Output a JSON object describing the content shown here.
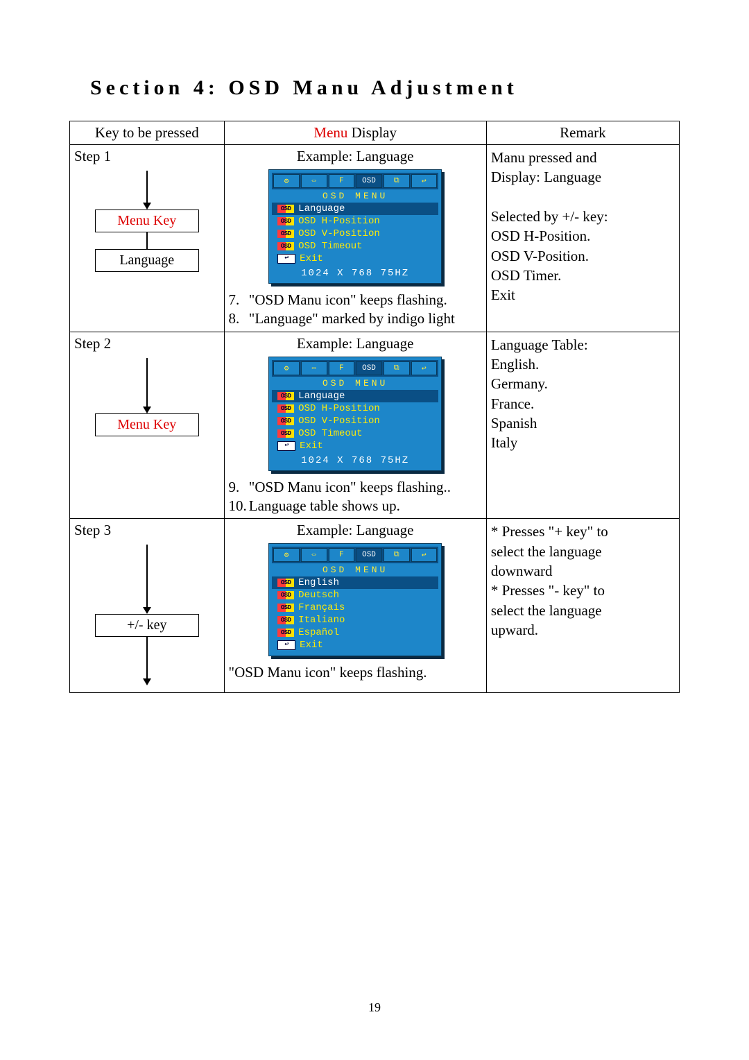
{
  "section_title": "Section 4: OSD Manu Adjustment",
  "page_number": "19",
  "table_header": {
    "col_key": "Key to be pressed",
    "col_display_prefix": "Menu",
    "col_display_suffix": " Display",
    "col_remark": "Remark"
  },
  "osd_common": {
    "menu_title": "OSD   MENU",
    "resolution": "1024 X 768 75HZ",
    "tabs": [
      "⚙",
      "⇔",
      "F",
      "OSD",
      "⧉",
      "↩"
    ]
  },
  "step1": {
    "label": "Step 1",
    "key_box1": "Menu Key",
    "key_box2": "Language",
    "display_caption": "Example: Language",
    "osd_items": [
      {
        "tag": "OSD",
        "text": "Language",
        "selected": true
      },
      {
        "tag": "OSD",
        "text": "OSD H-Position",
        "selected": false
      },
      {
        "tag": "OSD",
        "text": "OSD V-Position",
        "selected": false
      },
      {
        "tag": "OSD",
        "text": "OSD Timeout",
        "selected": false
      },
      {
        "tag": "EXIT",
        "text": "Exit",
        "selected": false
      }
    ],
    "notes": [
      {
        "n": "7.",
        "t": "\"OSD Manu icon\" keeps flashing."
      },
      {
        "n": "8.",
        "t": "\"Language\" marked by indigo light"
      }
    ],
    "remark_lines": [
      "Manu pressed and",
      "Display: Language",
      "",
      "Selected by +/- key:",
      "OSD H-Position.",
      "OSD V-Position.",
      "OSD Timer.",
      "Exit"
    ]
  },
  "step2": {
    "label": "Step 2",
    "key_box1": "Menu Key",
    "display_caption": "Example: Language",
    "osd_items": [
      {
        "tag": "OSD",
        "text": "Language",
        "selected": true
      },
      {
        "tag": "OSD",
        "text": "OSD H-Position",
        "selected": false
      },
      {
        "tag": "OSD",
        "text": "OSD V-Position",
        "selected": false
      },
      {
        "tag": "OSD",
        "text": "OSD Timeout",
        "selected": false
      },
      {
        "tag": "EXIT",
        "text": "Exit",
        "selected": false
      }
    ],
    "notes": [
      {
        "n": "9.",
        "t": "\"OSD Manu icon\" keeps flashing.."
      },
      {
        "n": "10.",
        "t": "Language table shows up."
      }
    ],
    "remark_lines": [
      "Language Table:",
      "English.",
      "Germany.",
      "France.",
      "Spanish",
      "Italy"
    ]
  },
  "step3": {
    "label": "Step 3",
    "key_box1": "+/- key",
    "display_caption": "Example: Language",
    "osd_items": [
      {
        "tag": "OSD",
        "text": "English",
        "selected": true
      },
      {
        "tag": "OSD",
        "text": "Deutsch",
        "selected": false
      },
      {
        "tag": "OSD",
        "text": "Français",
        "selected": false
      },
      {
        "tag": "OSD",
        "text": "Italiano",
        "selected": false
      },
      {
        "tag": "OSD",
        "text": "Español",
        "selected": false
      },
      {
        "tag": "EXIT",
        "text": "Exit",
        "selected": false
      }
    ],
    "notes_single": "\"OSD Manu icon\" keeps flashing.",
    "remark_lines": [
      "* Presses   \"+ key\" to",
      "select the language",
      "downward",
      "* Presses \"- key\" to",
      "select the language",
      "upward."
    ]
  }
}
